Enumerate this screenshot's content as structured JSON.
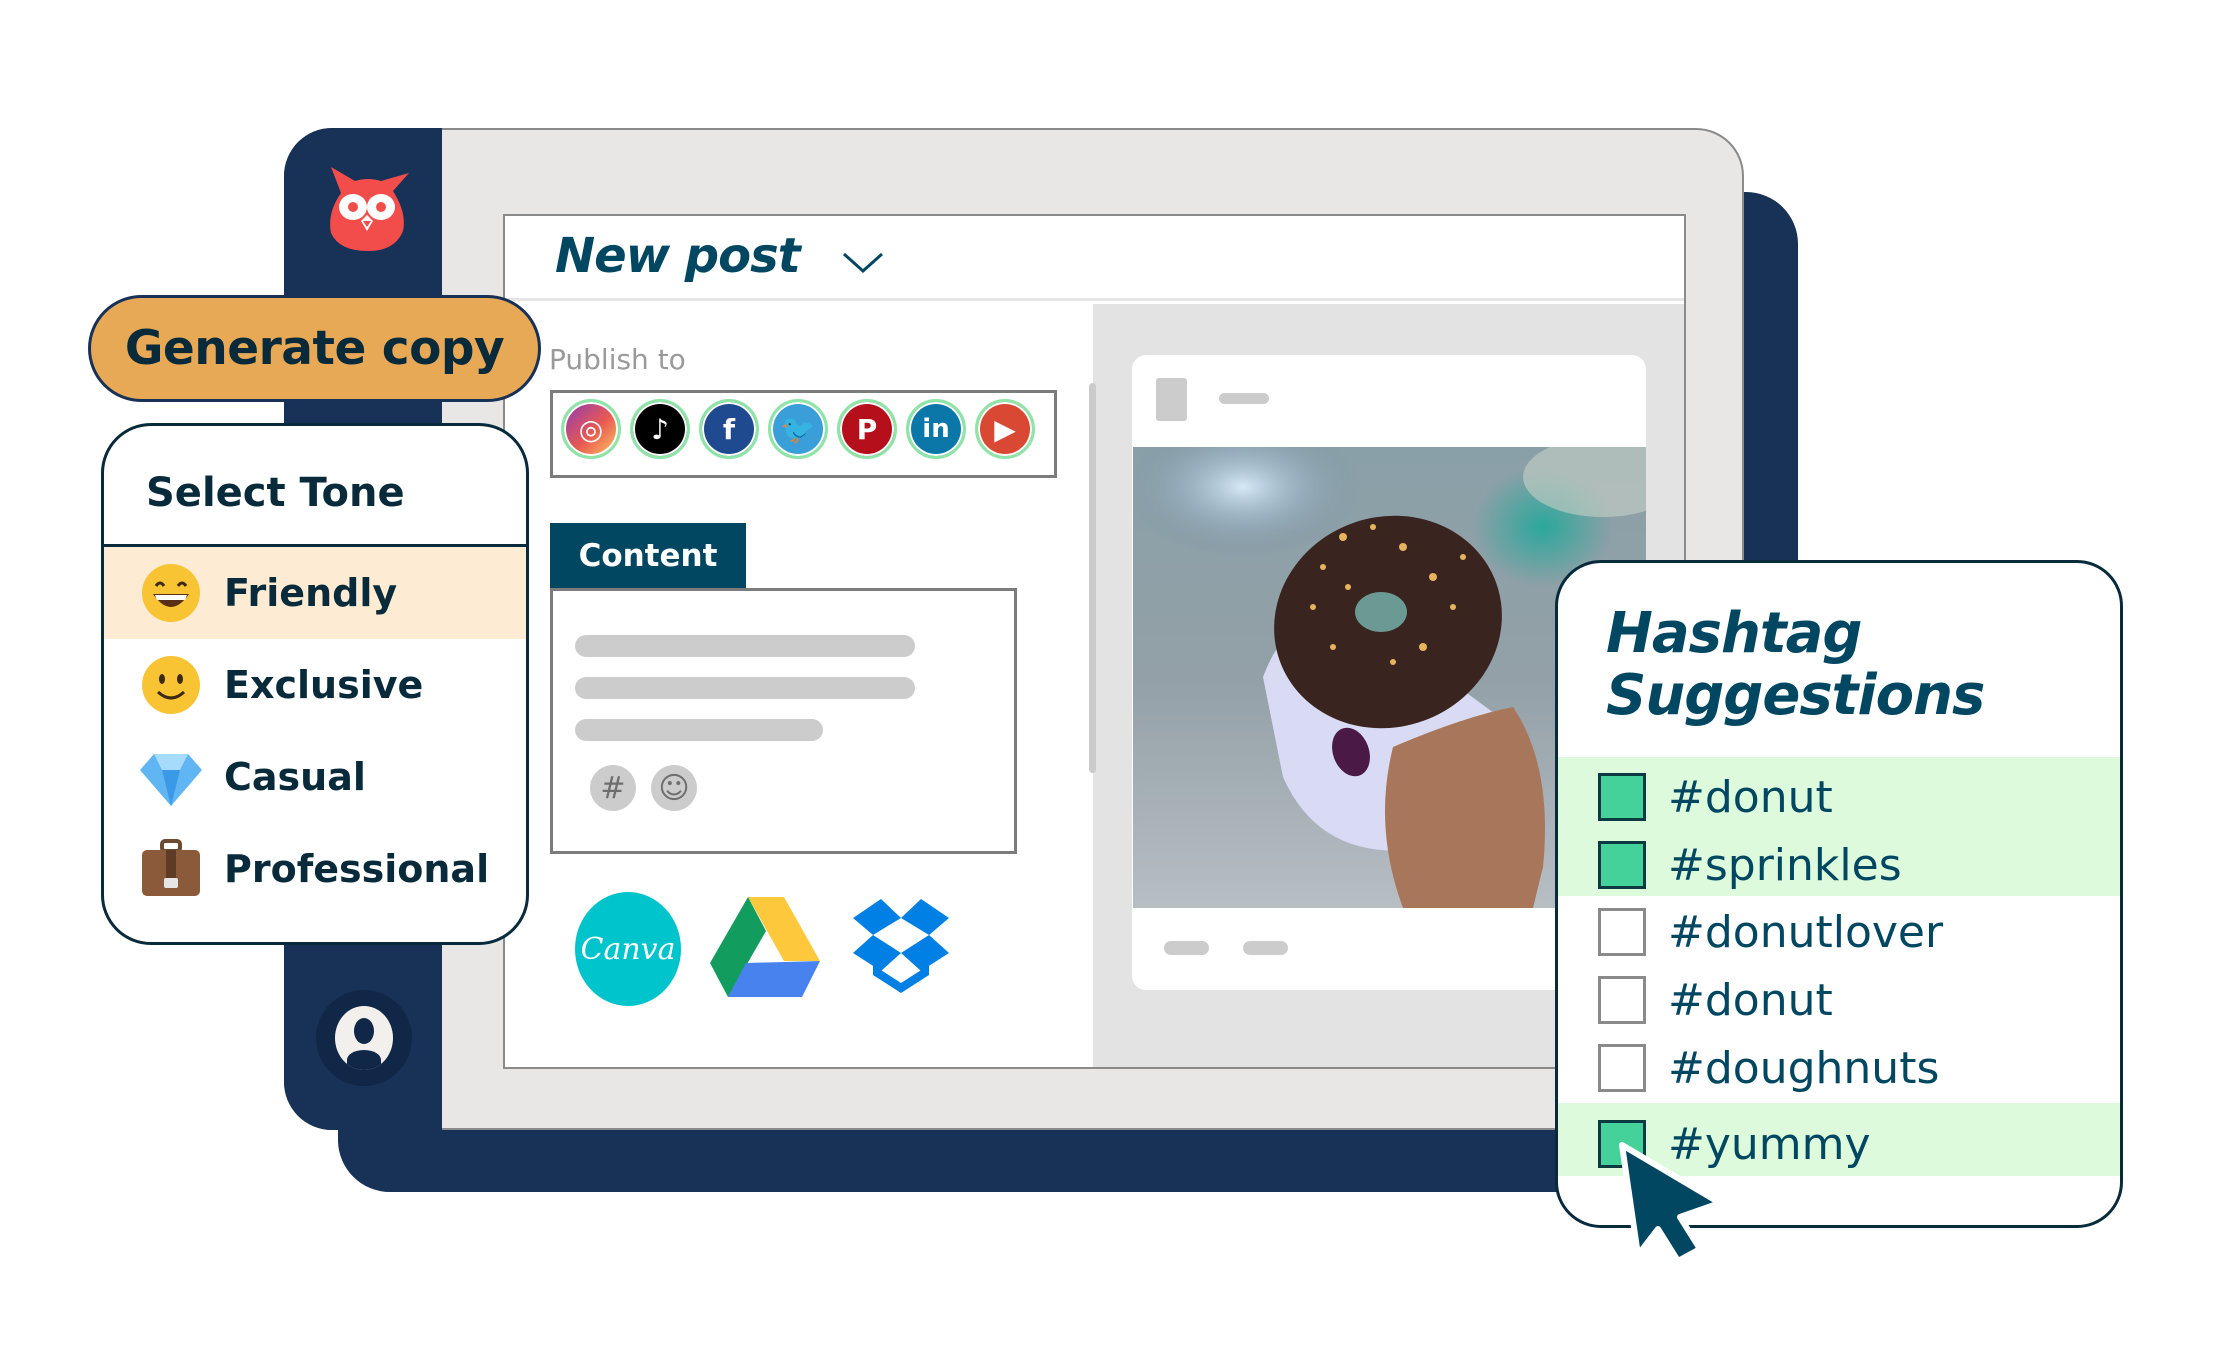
{
  "app": {
    "brand": "Hootsuite",
    "logo_icon": "owl-logo-icon",
    "user_icon": "user-avatar-icon"
  },
  "colors": {
    "navy": "#173157",
    "teal_text": "#024761",
    "generate_button": "#e8a957",
    "selected_tone_bg": "#fdebd3",
    "selected_hashtag_bg": "#ddfbdc",
    "checkbox_on": "#44d19a"
  },
  "composer": {
    "title": "New post",
    "dropdown_icon": "chevron-down-icon",
    "publish_to_label": "Publish to",
    "networks": [
      {
        "name": "Instagram",
        "icon": "instagram-icon",
        "glyph": "◎",
        "color": "#c13584",
        "selected": true
      },
      {
        "name": "TikTok",
        "icon": "tiktok-icon",
        "glyph": "♪",
        "color": "#000000",
        "selected": true
      },
      {
        "name": "Facebook",
        "icon": "facebook-icon",
        "glyph": "f",
        "color": "#1f4a8f",
        "selected": true
      },
      {
        "name": "Twitter",
        "icon": "twitter-icon",
        "glyph": "🐦",
        "color": "#3a9fd8",
        "selected": true
      },
      {
        "name": "Pinterest",
        "icon": "pinterest-icon",
        "glyph": "P",
        "color": "#b50f1c",
        "selected": true
      },
      {
        "name": "LinkedIn",
        "icon": "linkedin-icon",
        "glyph": "in",
        "color": "#0a77a8",
        "selected": true
      },
      {
        "name": "YouTube",
        "icon": "youtube-icon",
        "glyph": "▶",
        "color": "#d94832",
        "selected": true
      }
    ],
    "content_tab_label": "Content",
    "content_tools": [
      {
        "name": "hashtag",
        "glyph": "#"
      },
      {
        "name": "emoji",
        "glyph": "☺"
      }
    ],
    "media_sources": [
      {
        "name": "Canva",
        "label": "Canva"
      },
      {
        "name": "Google Drive",
        "label": ""
      },
      {
        "name": "Dropbox",
        "label": ""
      }
    ]
  },
  "ai": {
    "generate_button": "Generate copy",
    "tone_title": "Select Tone",
    "tones": [
      {
        "label": "Friendly",
        "emoji": "😄",
        "selected": true
      },
      {
        "label": "Exclusive",
        "emoji": "🙂",
        "selected": false
      },
      {
        "label": "Casual",
        "emoji": "💎",
        "selected": false
      },
      {
        "label": "Professional",
        "emoji": "💼",
        "selected": false
      }
    ]
  },
  "hashtags": {
    "title_line1": "Hashtag",
    "title_line2": "Suggestions",
    "items": [
      {
        "label": "#donut",
        "checked": true
      },
      {
        "label": "#sprinkles",
        "checked": true
      },
      {
        "label": "#donutlover",
        "checked": false
      },
      {
        "label": "#donut",
        "checked": false
      },
      {
        "label": "#doughnuts",
        "checked": false
      },
      {
        "label": "#yummy",
        "checked": true
      }
    ]
  },
  "preview": {
    "image_subject": "chocolate donut with sprinkles held in hand"
  }
}
